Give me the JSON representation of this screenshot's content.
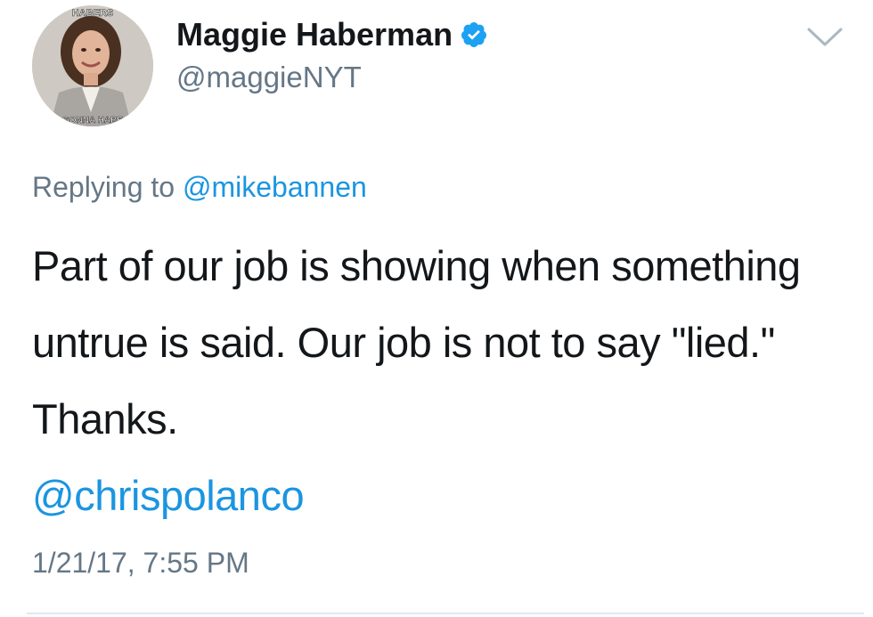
{
  "author": {
    "display_name": "Maggie Haberman",
    "handle": "@maggieNYT",
    "verified": true,
    "verified_icon": "verified-badge-icon",
    "avatar_overlay_top": "HABERS",
    "avatar_overlay_bottom": "GONNA HABE"
  },
  "menu": {
    "icon": "chevron-down-icon"
  },
  "reply_context": {
    "prefix": "Replying to",
    "mention": "@mikebannen"
  },
  "tweet": {
    "text": "Part of our job is showing when something untrue is said. Our job is not to say \"lied.\" Thanks.",
    "mention": "@chrispolanco"
  },
  "timestamp": "1/21/17, 7:55 PM",
  "colors": {
    "text": "#14171a",
    "secondary": "#657786",
    "link": "#1b95e0",
    "verified": "#1da1f2",
    "divider": "#e1e8ed"
  }
}
